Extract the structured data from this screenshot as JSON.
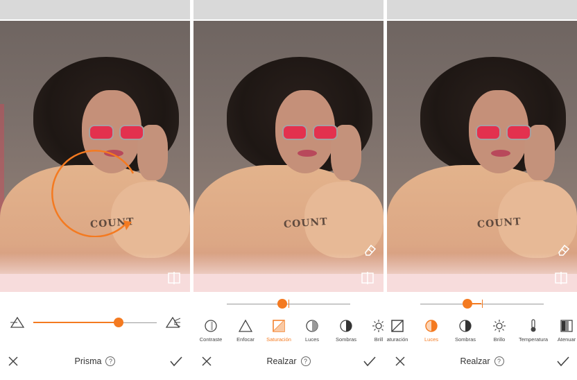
{
  "panels": [
    {
      "title": "Prisma",
      "help": "?",
      "slider_value_pct": 68
    },
    {
      "title": "Realzar",
      "help": "?",
      "slider_value_pct": 45,
      "tools": [
        {
          "label": "Contraste",
          "icon": "contrast-icon"
        },
        {
          "label": "Enfocar",
          "icon": "sharpen-icon"
        },
        {
          "label": "Saturación",
          "icon": "saturation-icon",
          "active": true
        },
        {
          "label": "Luces",
          "icon": "highlights-icon"
        },
        {
          "label": "Sombras",
          "icon": "shadows-icon"
        },
        {
          "label": "Brill",
          "icon": "brightness-icon"
        }
      ]
    },
    {
      "title": "Realzar",
      "help": "?",
      "slider_value_pct": 38,
      "tools": [
        {
          "label": "aturación",
          "icon": "saturation-icon"
        },
        {
          "label": "Luces",
          "icon": "highlights-icon",
          "active": true
        },
        {
          "label": "Sombras",
          "icon": "shadows-icon"
        },
        {
          "label": "Brillo",
          "icon": "brightness-icon"
        },
        {
          "label": "Temperatura",
          "icon": "temperature-icon"
        },
        {
          "label": "Atenuar",
          "icon": "fade-icon"
        }
      ]
    }
  ],
  "photo_text": "COUNT",
  "colors": {
    "accent": "#f47a20",
    "toolbar_text": "#444444"
  }
}
